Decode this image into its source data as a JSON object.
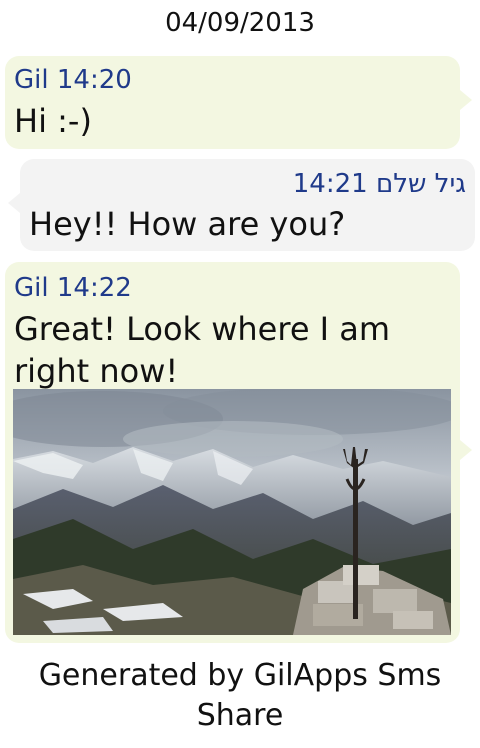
{
  "date_header": "04/09/2013",
  "messages": [
    {
      "sender": "Gil",
      "time": "14:20",
      "text": "Hi :-)"
    },
    {
      "sender": "גיל שלם",
      "time": "14:21",
      "text": "Hey!! How are you?"
    },
    {
      "sender": "Gil",
      "time": "14:22",
      "text_line1": "Great! Look where I am",
      "text_line2": "right now!"
    }
  ],
  "footer_line1": "Generated by GilApps Sms",
  "footer_line2": "Share",
  "colors": {
    "outgoing_bubble": "#f3f7e1",
    "incoming_bubble": "#f3f3f3",
    "meta_text": "#1f3a8a"
  }
}
